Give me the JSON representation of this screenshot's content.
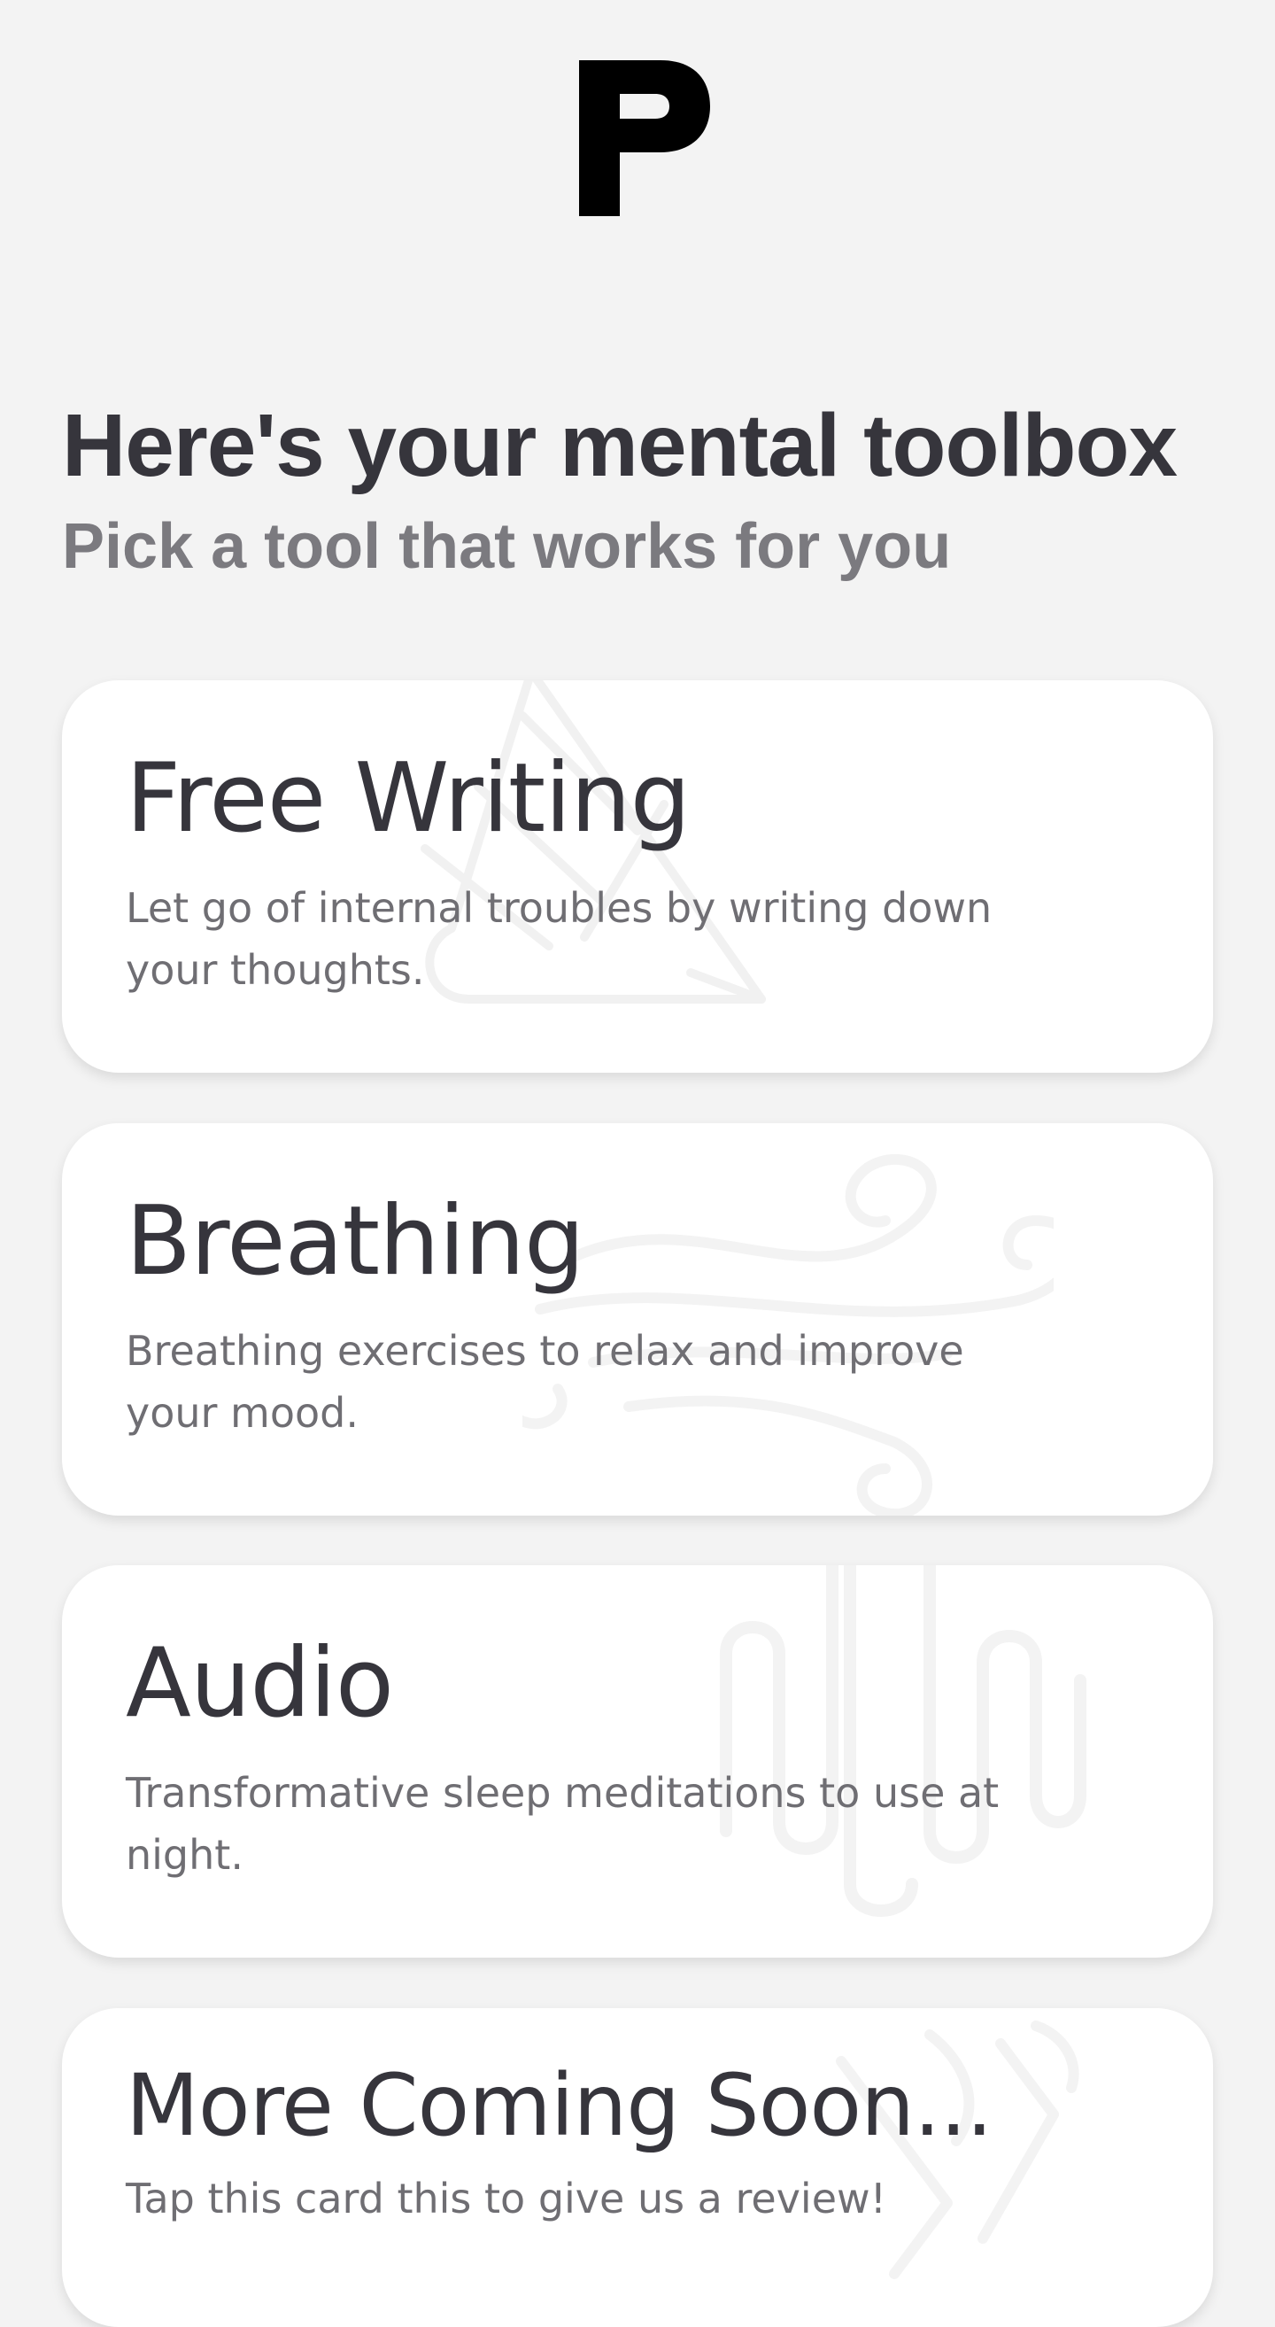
{
  "header": {
    "logo_icon": "p-logo-icon"
  },
  "toolbox": {
    "title": "Here's your mental toolbox",
    "subtitle": "Pick a tool that works for you"
  },
  "cards": [
    {
      "title": "Free Writing",
      "description": "Let go of internal troubles by writing down your thoughts.",
      "icon": "pencil-icon"
    },
    {
      "title": "Breathing",
      "description": "Breathing exercises to relax and improve your mood.",
      "icon": "wind-icon"
    },
    {
      "title": "Audio",
      "description": "Transformative sleep meditations to use at night.",
      "icon": "sound-wave-icon"
    },
    {
      "title": "More Coming Soon...",
      "description": "Tap this card this to give us a review!",
      "icon": "toolbox-icon"
    }
  ],
  "colors": {
    "background": "#f3f3f3",
    "card": "#ffffff",
    "heading": "#36353c",
    "subheading": "#7b7a7f",
    "body_text": "#6f6e73"
  }
}
